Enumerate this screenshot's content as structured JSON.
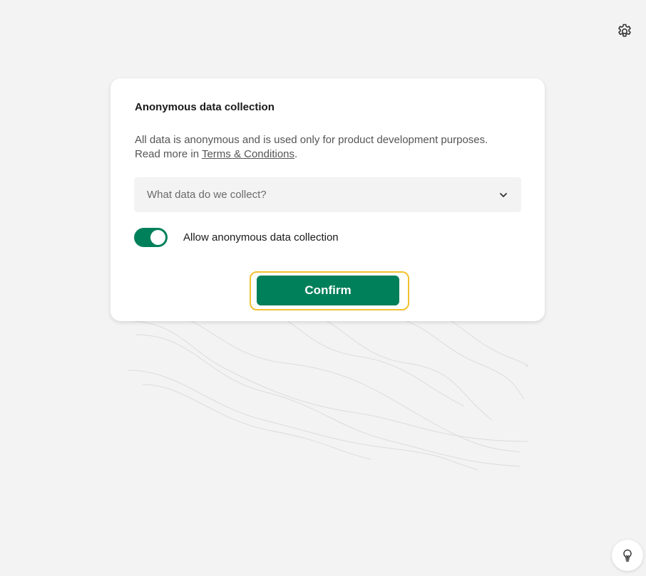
{
  "toolbar": {
    "settings_icon": "gear-icon"
  },
  "dialog": {
    "title": "Anonymous data collection",
    "description_line1": "All data is anonymous and is used only for product development purposes.",
    "description_prefix": "Read more in ",
    "terms_link": "Terms & Conditions",
    "description_suffix": ".",
    "accordion_label": "What data do we collect?",
    "toggle_label": "Allow anonymous data collection",
    "toggle_on": true,
    "confirm_label": "Confirm"
  },
  "hint": {
    "icon": "lightbulb-icon"
  },
  "colors": {
    "accent": "#00805a",
    "focus_ring": "#f2c12e",
    "background": "#f3f3f3"
  }
}
